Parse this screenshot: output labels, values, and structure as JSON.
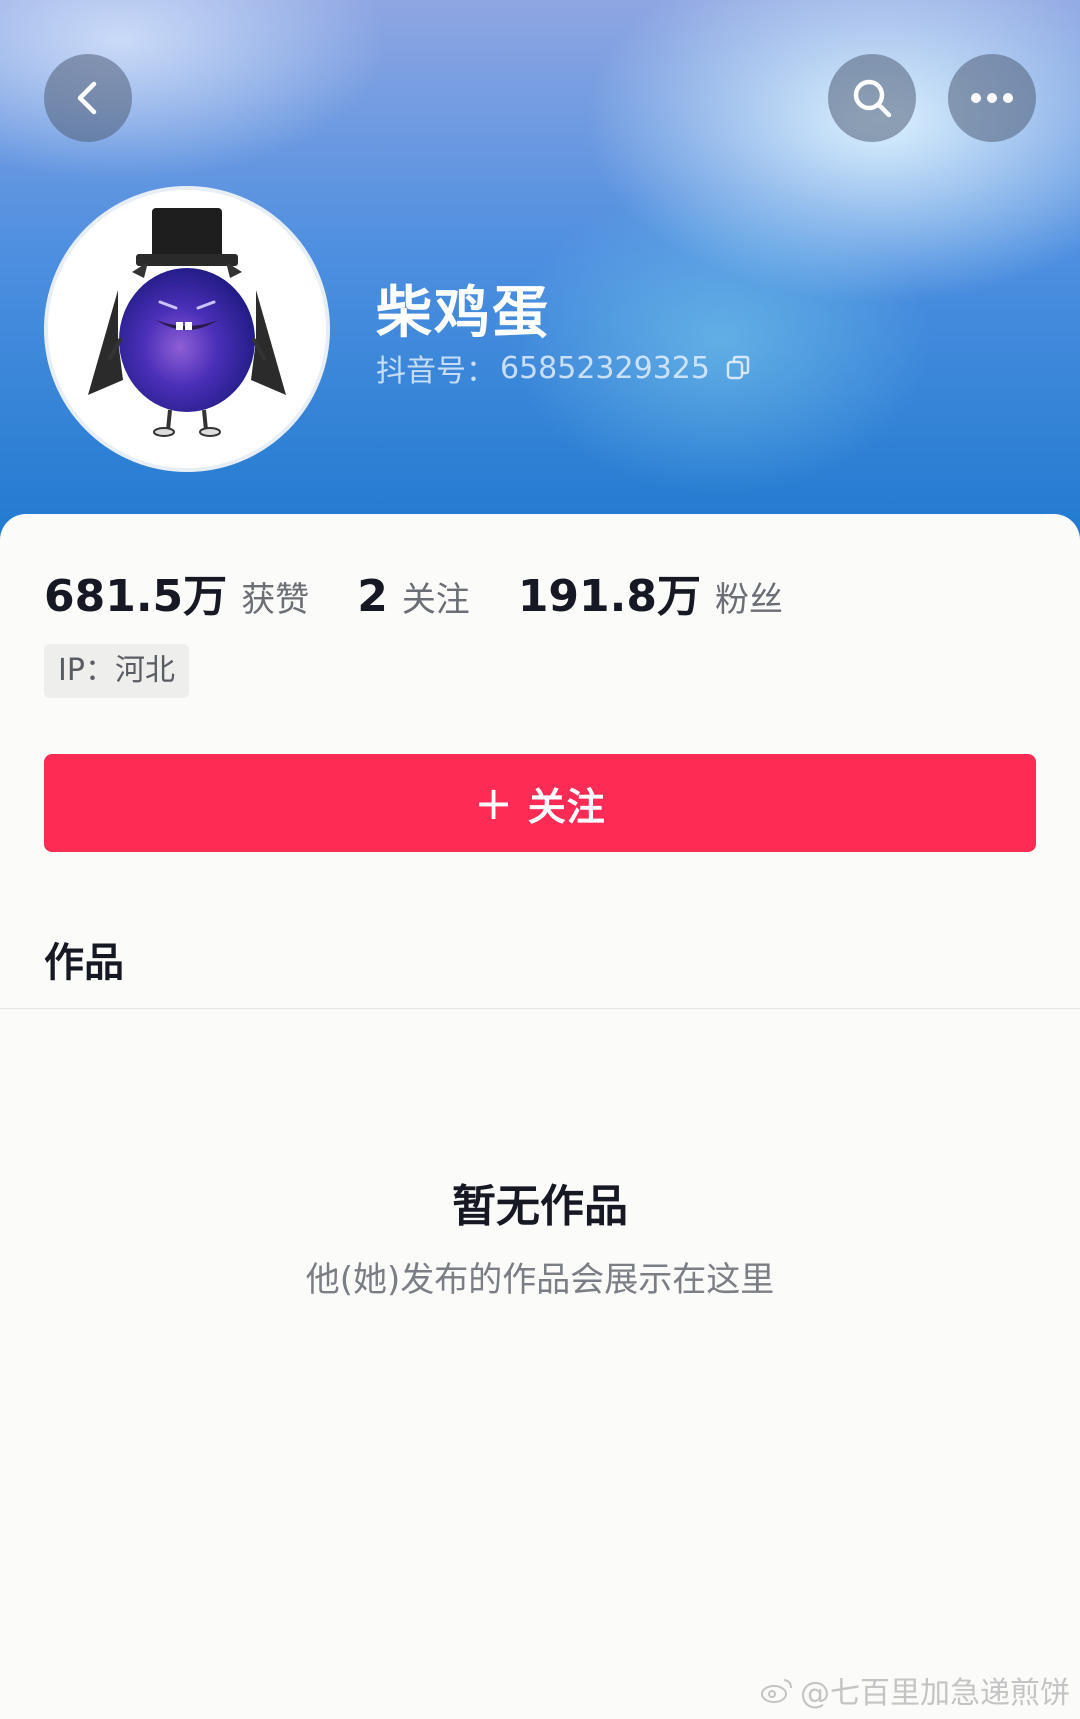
{
  "header": {
    "back_icon": "chevron-left-icon",
    "search_icon": "search-icon",
    "more_icon": "ellipsis-icon"
  },
  "profile": {
    "name": "柴鸡蛋",
    "account_label": "抖音号：",
    "account_id": "65852329325",
    "copy_icon": "copy-icon"
  },
  "stats": [
    {
      "value": "681.5万",
      "label": "获赞"
    },
    {
      "value": "2",
      "label": "关注"
    },
    {
      "value": "191.8万",
      "label": "粉丝"
    }
  ],
  "ip_tag": "IP：河北",
  "follow_button": {
    "plus": "+",
    "label": "关注"
  },
  "tabs": {
    "works": "作品"
  },
  "empty_state": {
    "title": "暂无作品",
    "subtitle": "他(她)发布的作品会展示在这里"
  },
  "watermark": "@七百里加急递煎饼",
  "colors": {
    "accent": "#fe2c55",
    "text_primary": "#161823",
    "header_blue": "#1e79cf"
  }
}
